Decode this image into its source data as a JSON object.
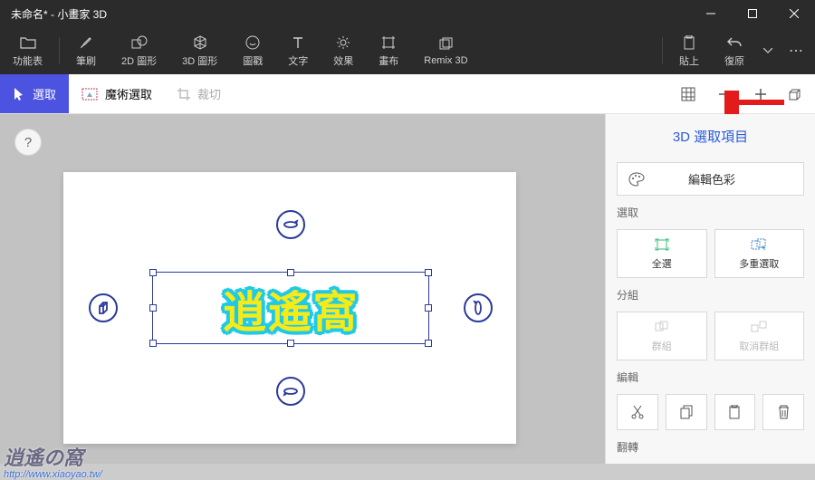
{
  "title": "未命名* - 小畫家 3D",
  "toolbar": {
    "menu": "功能表",
    "brush": "筆刷",
    "shapes2d": "2D 圖形",
    "shapes3d": "3D 圖形",
    "stickers": "圖戳",
    "text": "文字",
    "effects": "效果",
    "canvas": "畫布",
    "remix3d": "Remix 3D",
    "paste": "貼上",
    "undo": "復原"
  },
  "subbar": {
    "select": "選取",
    "magic_select": "魔術選取",
    "crop": "裁切"
  },
  "canvas_text": "逍遙窩",
  "panel": {
    "title": "3D 選取項目",
    "edit_color": "編輯色彩",
    "section_select": "選取",
    "select_all": "全選",
    "multi_select": "多重選取",
    "section_group": "分組",
    "group": "群組",
    "ungroup": "取消群組",
    "section_edit": "編輯",
    "section_flip": "翻轉"
  },
  "help": "?",
  "watermark": {
    "brand": "逍遙の窩",
    "url": "http://www.xiaoyao.tw/"
  }
}
